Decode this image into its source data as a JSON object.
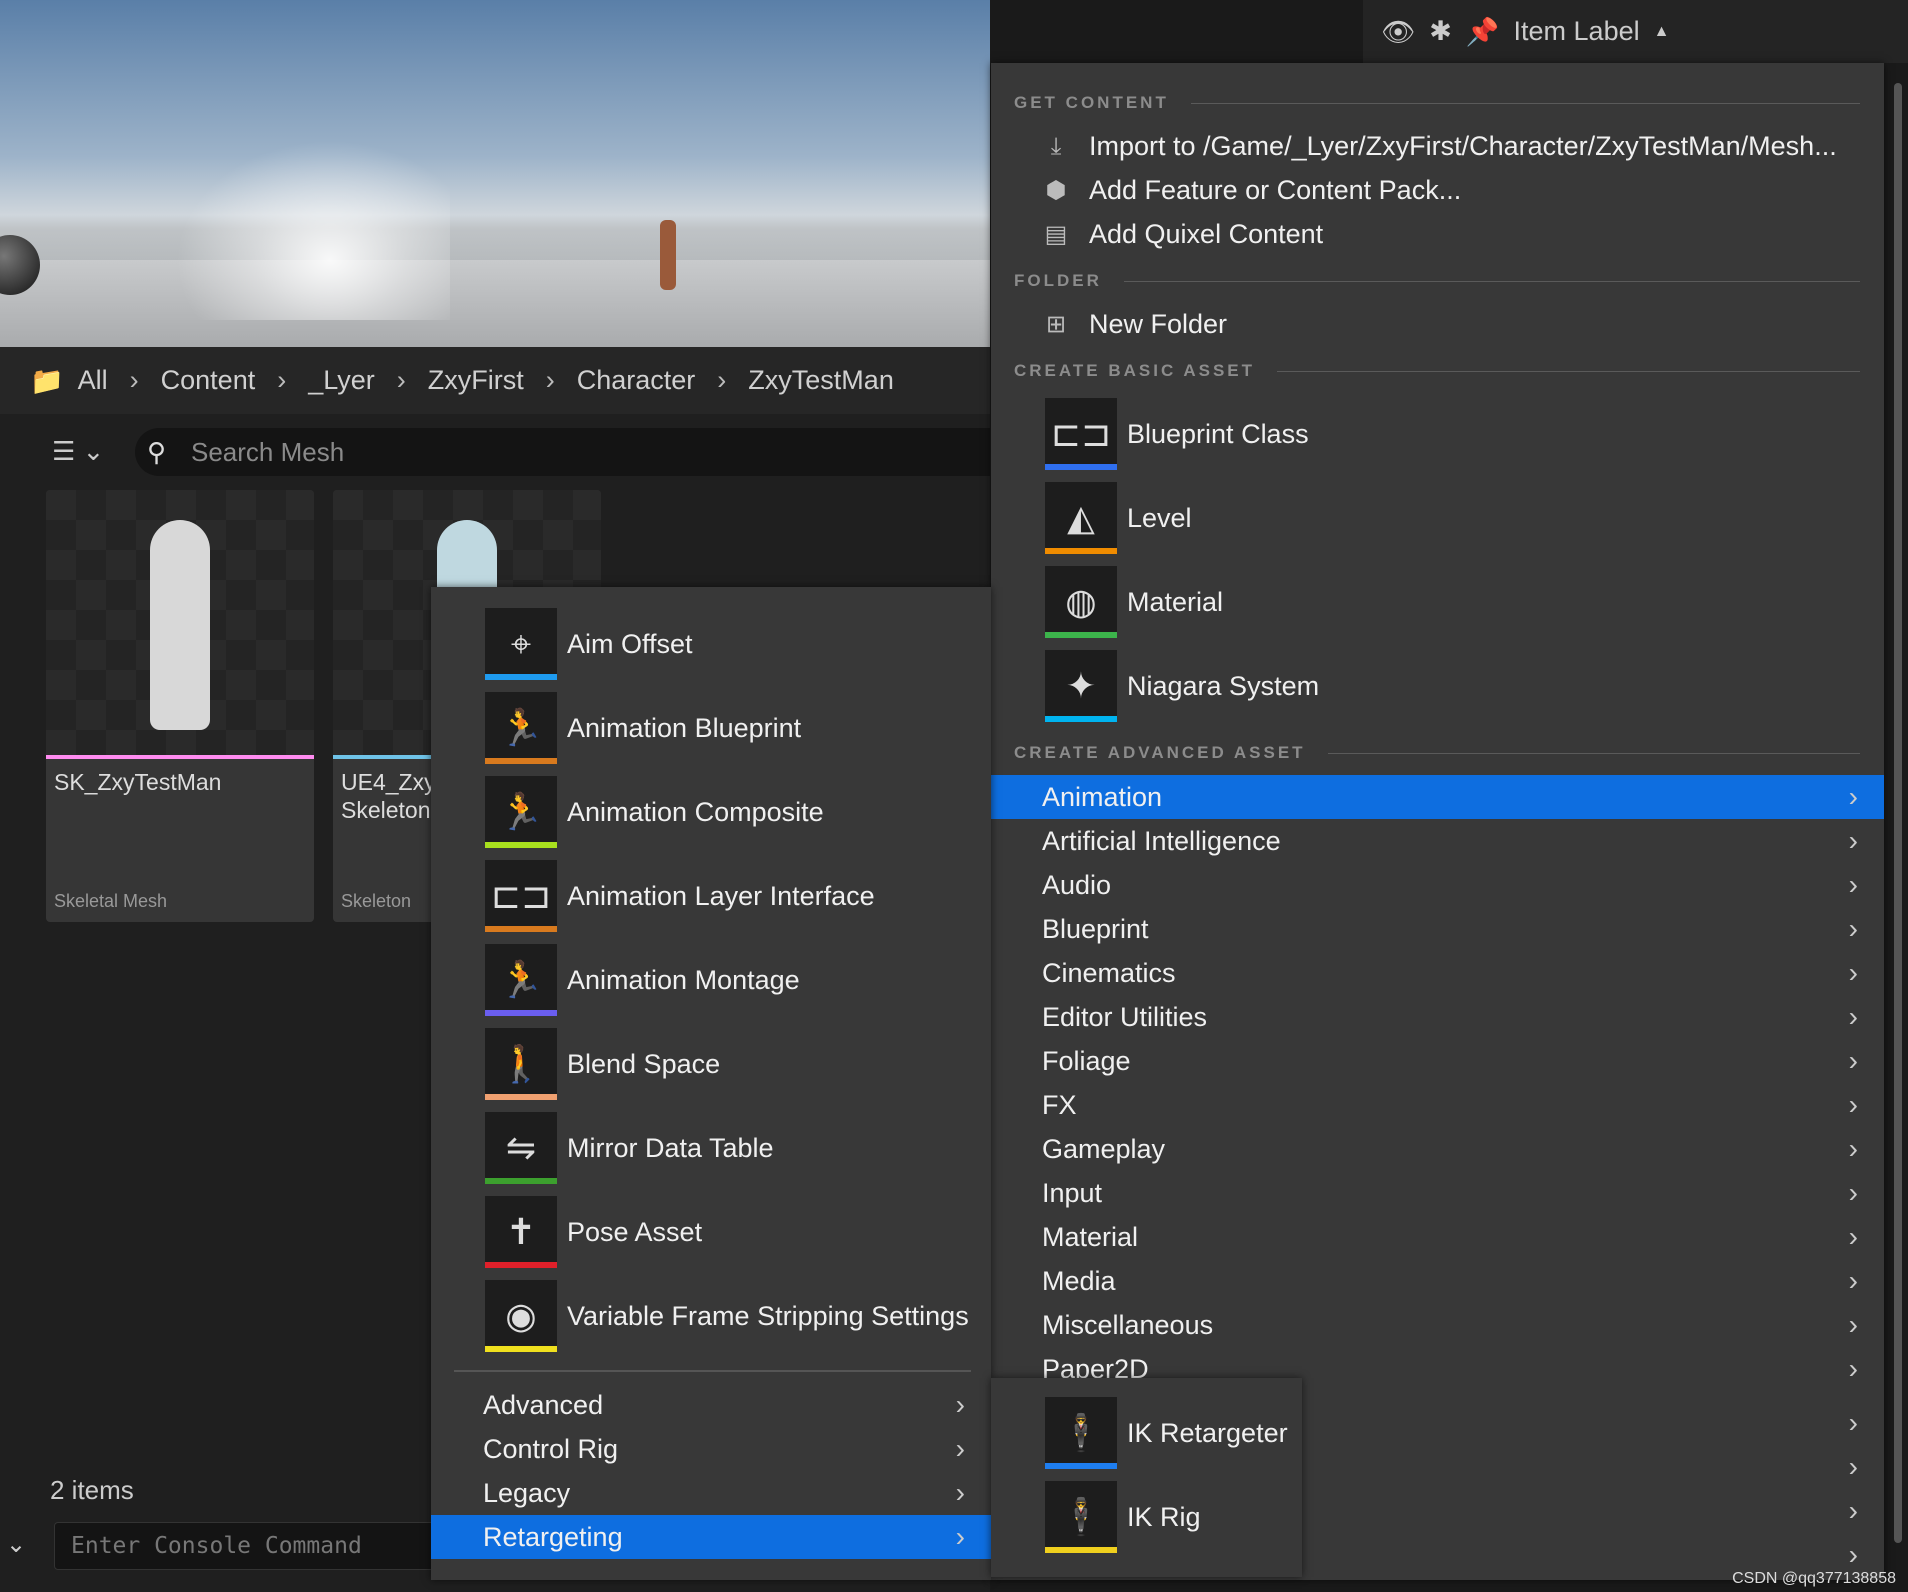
{
  "topbar": {
    "eye_icon": "eye-icon",
    "star_icon": "asterisk-icon",
    "pin_icon": "pin-icon",
    "label": "Item Label",
    "sort": "▲"
  },
  "breadcrumb": [
    "All",
    "Content",
    "_Lyer",
    "ZxyFirst",
    "Character",
    "ZxyTestMan"
  ],
  "search": {
    "placeholder": "Search Mesh"
  },
  "assets": [
    {
      "name": "SK_ZxyTestMan",
      "type": "Skeletal Mesh",
      "color": "#ff8cf0"
    },
    {
      "name": "UE4_Zxy\nSkeleton",
      "type": "Skeleton",
      "color": "#6fc3e8"
    }
  ],
  "status": {
    "count": "2 items",
    "console_placeholder": "Enter Console Command"
  },
  "main_menu": {
    "get_content": "GET CONTENT",
    "get_items": [
      "Import to /Game/_Lyer/ZxyFirst/Character/ZxyTestMan/Mesh...",
      "Add Feature or Content Pack...",
      "Add Quixel Content"
    ],
    "folder": "FOLDER",
    "new_folder": "New Folder",
    "basic": "CREATE BASIC ASSET",
    "basic_items": [
      {
        "label": "Blueprint Class",
        "color": "#2f6ff0"
      },
      {
        "label": "Level",
        "color": "#f08c00"
      },
      {
        "label": "Material",
        "color": "#3cb44b"
      },
      {
        "label": "Niagara System",
        "color": "#00b4f0"
      }
    ],
    "advanced": "CREATE ADVANCED ASSET",
    "categories": [
      "Animation",
      "Artificial Intelligence",
      "Audio",
      "Blueprint",
      "Cinematics",
      "Editor Utilities",
      "Foliage",
      "FX",
      "Gameplay",
      "Input",
      "Material",
      "Media",
      "Miscellaneous",
      "Paper2D"
    ],
    "selected": "Animation"
  },
  "anim_menu": {
    "items": [
      {
        "label": "Aim Offset",
        "color": "#1e9bf0"
      },
      {
        "label": "Animation Blueprint",
        "color": "#d87a1e"
      },
      {
        "label": "Animation Composite",
        "color": "#a8e01e"
      },
      {
        "label": "Animation Layer Interface",
        "color": "#d87a1e"
      },
      {
        "label": "Animation Montage",
        "color": "#6a5ef0"
      },
      {
        "label": "Blend Space",
        "color": "#f0a070"
      },
      {
        "label": "Mirror Data Table",
        "color": "#3ca02e"
      },
      {
        "label": "Pose Asset",
        "color": "#e0202a"
      },
      {
        "label": "Variable Frame Stripping Settings",
        "color": "#f0e01e"
      }
    ],
    "subs": [
      "Advanced",
      "Control Rig",
      "Legacy",
      "Retargeting"
    ],
    "selected": "Retargeting"
  },
  "retarget_menu": {
    "items": [
      {
        "label": "IK Retargeter",
        "color": "#1e7ef0"
      },
      {
        "label": "IK Rig",
        "color": "#f0d01e"
      }
    ]
  },
  "watermark": "CSDN @qq377138858"
}
